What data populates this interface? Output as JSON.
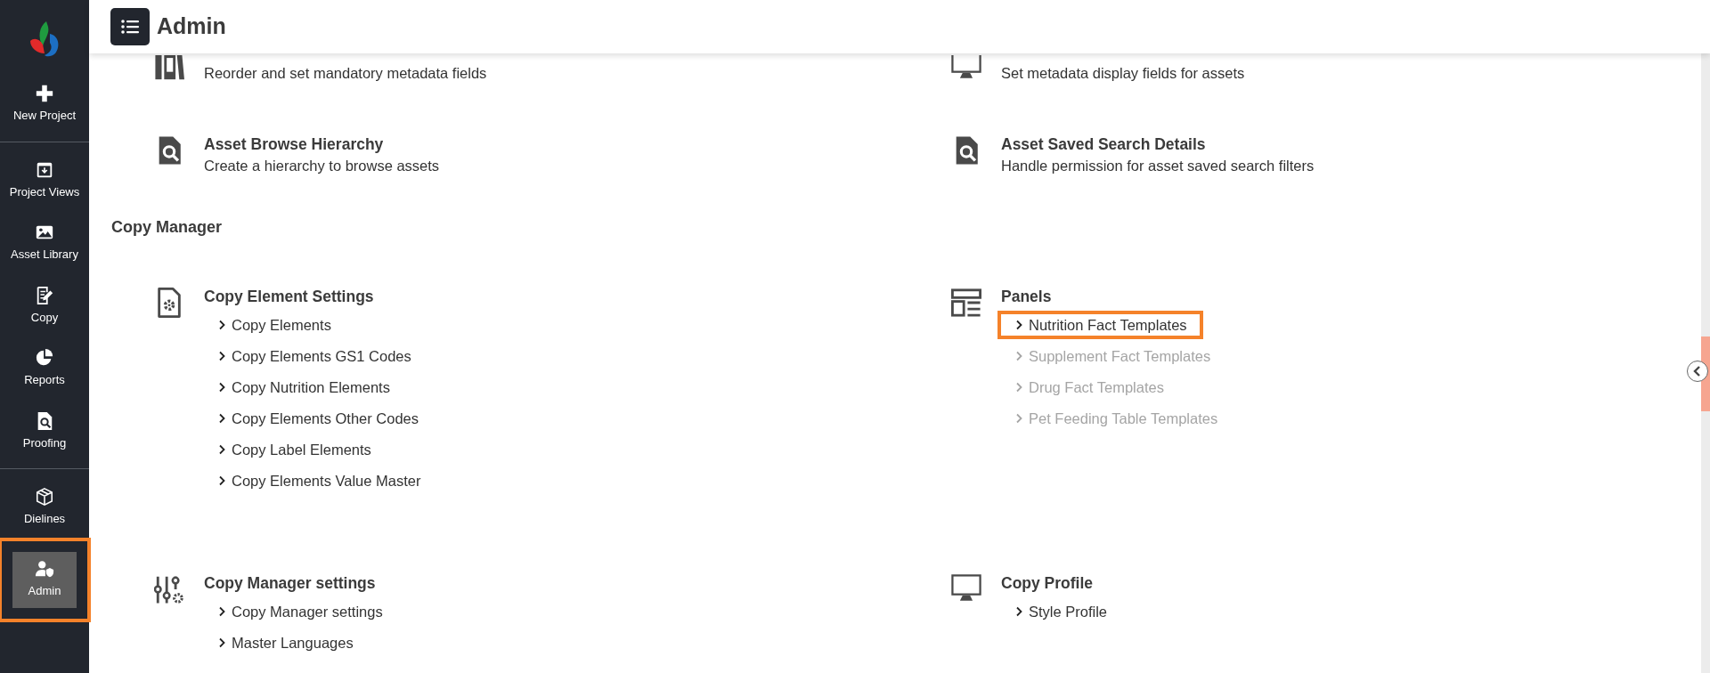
{
  "header": {
    "title": "Admin"
  },
  "sidebar": {
    "items": [
      {
        "label": "New Project",
        "selected": false,
        "highlighted": false,
        "divider_after": true
      },
      {
        "label": "Project Views",
        "selected": false,
        "highlighted": false,
        "divider_after": false
      },
      {
        "label": "Asset Library",
        "selected": false,
        "highlighted": false,
        "divider_after": false
      },
      {
        "label": "Copy",
        "selected": false,
        "highlighted": false,
        "divider_after": false
      },
      {
        "label": "Reports",
        "selected": false,
        "highlighted": false,
        "divider_after": false
      },
      {
        "label": "Proofing",
        "selected": false,
        "highlighted": false,
        "divider_after": true
      },
      {
        "label": "Dielines",
        "selected": false,
        "highlighted": false,
        "divider_after": false
      },
      {
        "label": "Admin",
        "selected": true,
        "highlighted": true,
        "divider_after": false
      }
    ]
  },
  "sections": [
    {
      "cards": [
        {
          "description": "Reorder and set mandatory metadata fields"
        },
        {
          "description": "Set metadata display fields for assets"
        },
        {
          "title": "Asset Browse Hierarchy",
          "description": "Create a hierarchy to browse assets"
        },
        {
          "title": "Asset Saved Search Details",
          "description": "Handle permission for asset saved search filters"
        }
      ]
    },
    {
      "heading": "Copy Manager",
      "cards": [
        {
          "title": "Copy Element Settings",
          "links": [
            {
              "label": "Copy Elements",
              "disabled": false,
              "highlighted": false
            },
            {
              "label": "Copy Elements GS1 Codes",
              "disabled": false,
              "highlighted": false
            },
            {
              "label": "Copy Nutrition Elements",
              "disabled": false,
              "highlighted": false
            },
            {
              "label": "Copy Elements Other Codes",
              "disabled": false,
              "highlighted": false
            },
            {
              "label": "Copy Label Elements",
              "disabled": false,
              "highlighted": false
            },
            {
              "label": "Copy Elements Value Master",
              "disabled": false,
              "highlighted": false
            }
          ]
        },
        {
          "title": "Panels",
          "links": [
            {
              "label": "Nutrition Fact Templates",
              "disabled": false,
              "highlighted": true
            },
            {
              "label": "Supplement Fact Templates",
              "disabled": true,
              "highlighted": false
            },
            {
              "label": "Drug Fact Templates",
              "disabled": true,
              "highlighted": false
            },
            {
              "label": "Pet Feeding Table Templates",
              "disabled": true,
              "highlighted": false
            }
          ]
        },
        {
          "title": "Copy Manager settings",
          "links": [
            {
              "label": "Copy Manager settings",
              "disabled": false,
              "highlighted": false
            },
            {
              "label": "Master Languages",
              "disabled": false,
              "highlighted": false
            }
          ]
        },
        {
          "title": "Copy Profile",
          "links": [
            {
              "label": "Style Profile",
              "disabled": false,
              "highlighted": false
            }
          ]
        }
      ]
    }
  ]
}
